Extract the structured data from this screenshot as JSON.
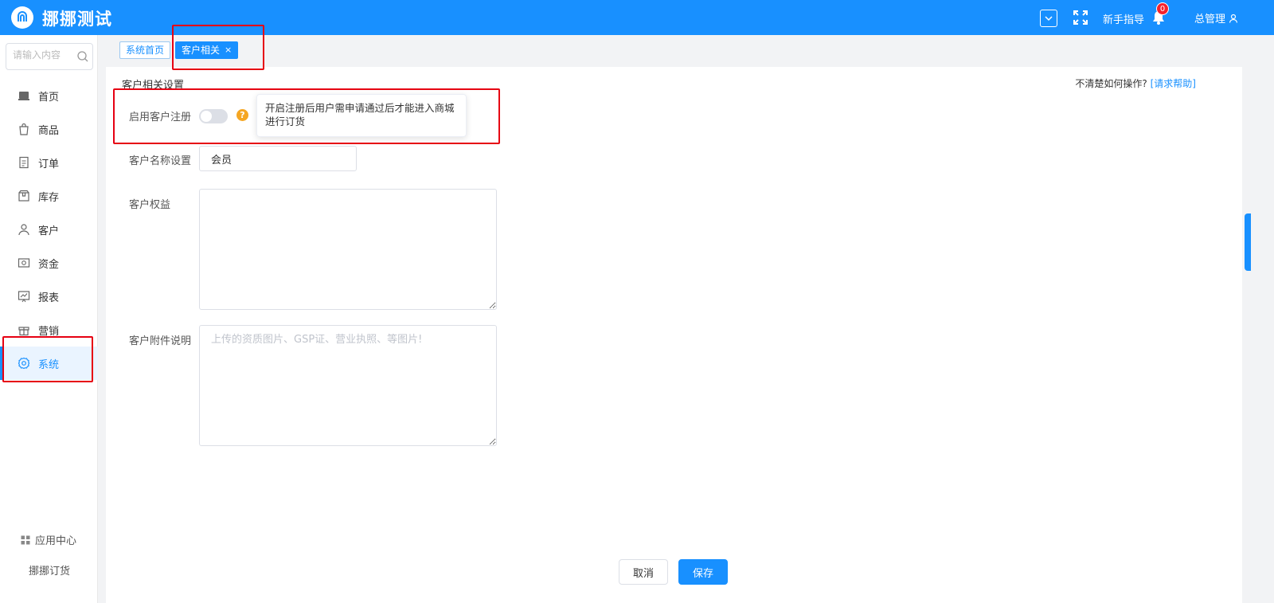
{
  "topbar": {
    "brand": "挪挪测试",
    "guide_label": "新手指导",
    "notification_count": "0",
    "user_label": "总管理"
  },
  "sidebar": {
    "search_placeholder": "请输入内容",
    "items": [
      {
        "label": "首页",
        "icon": "home-icon"
      },
      {
        "label": "商品",
        "icon": "bag-icon"
      },
      {
        "label": "订单",
        "icon": "document-icon"
      },
      {
        "label": "库存",
        "icon": "box-icon"
      },
      {
        "label": "客户",
        "icon": "user-icon"
      },
      {
        "label": "资金",
        "icon": "money-icon"
      },
      {
        "label": "报表",
        "icon": "chart-icon"
      },
      {
        "label": "营销",
        "icon": "gift-icon"
      },
      {
        "label": "系统",
        "icon": "gear-icon"
      }
    ],
    "active_item": "系统",
    "footer_apps": "应用中心",
    "footer_brand": "挪挪订货"
  },
  "tabs": [
    {
      "label": "系统首页"
    },
    {
      "label": "客户相关"
    }
  ],
  "main": {
    "section_title": "客户相关设置",
    "help_prefix": "不清楚如何操作?",
    "help_link": "[请求帮助]",
    "fields": {
      "enable_registration_label": "启用客户注册",
      "enable_registration_on": false,
      "tooltip_text": "开启注册后用户需申请通过后才能进入商城进行订货",
      "name_setting_label": "客户名称设置",
      "name_setting_value": "会员",
      "benefits_label": "客户权益",
      "benefits_value": "",
      "attachment_label": "客户附件说明",
      "attachment_placeholder": "上传的资质图片、GSP证、营业执照、等图片!"
    },
    "cancel_label": "取消",
    "save_label": "保存"
  },
  "colors": {
    "primary": "#1890ff",
    "annotation_red": "#e60012",
    "help_icon": "#f5a623"
  }
}
